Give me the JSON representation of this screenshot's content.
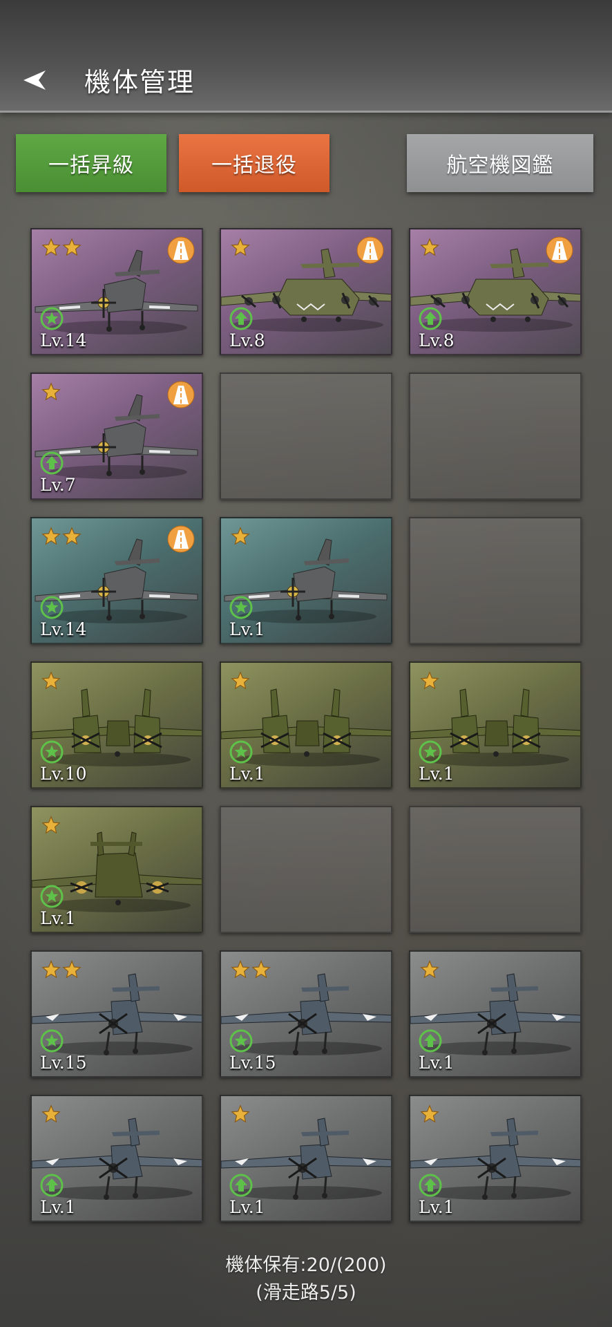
{
  "header": {
    "title": "機体管理"
  },
  "actions": {
    "bulk_upgrade": "一括昇級",
    "bulk_retire": "一括退役",
    "catalog": "航空機図鑑"
  },
  "colors": {
    "upgrade_button": "#4f9637",
    "retire_button": "#de6434",
    "catalog_button": "#999b9d",
    "star": "#e8b23a",
    "runway_badge": "#f0a040",
    "status_green": "#5ec24a"
  },
  "grid": {
    "columns": 3,
    "slots": [
      {
        "empty": false,
        "rarity": "purple",
        "stars": 2,
        "runway": true,
        "status": "star",
        "plane": "fighter",
        "level": "Lv.14"
      },
      {
        "empty": false,
        "rarity": "purple",
        "stars": 1,
        "runway": true,
        "status": "upgrade",
        "plane": "bomber4",
        "level": "Lv.8"
      },
      {
        "empty": false,
        "rarity": "purple",
        "stars": 1,
        "runway": true,
        "status": "upgrade",
        "plane": "bomber4",
        "level": "Lv.8"
      },
      {
        "empty": false,
        "rarity": "purple",
        "stars": 1,
        "runway": true,
        "status": "upgrade",
        "plane": "fighter",
        "level": "Lv.7"
      },
      {
        "empty": true
      },
      {
        "empty": true
      },
      {
        "empty": false,
        "rarity": "teal",
        "stars": 2,
        "runway": true,
        "status": "star",
        "plane": "fighter",
        "level": "Lv.14"
      },
      {
        "empty": false,
        "rarity": "teal",
        "stars": 1,
        "runway": false,
        "status": "star",
        "plane": "fighter",
        "level": "Lv.1"
      },
      {
        "empty": true
      },
      {
        "empty": false,
        "rarity": "olive",
        "stars": 1,
        "runway": false,
        "status": "star",
        "plane": "twin",
        "level": "Lv.10"
      },
      {
        "empty": false,
        "rarity": "olive",
        "stars": 1,
        "runway": false,
        "status": "star",
        "plane": "twin",
        "level": "Lv.1"
      },
      {
        "empty": false,
        "rarity": "olive",
        "stars": 1,
        "runway": false,
        "status": "star",
        "plane": "twin",
        "level": "Lv.1"
      },
      {
        "empty": false,
        "rarity": "olive",
        "stars": 1,
        "runway": false,
        "status": "star",
        "plane": "bomber2",
        "level": "Lv.1"
      },
      {
        "empty": true
      },
      {
        "empty": true
      },
      {
        "empty": false,
        "rarity": "gray",
        "stars": 2,
        "runway": false,
        "status": "star",
        "plane": "navy",
        "level": "Lv.15"
      },
      {
        "empty": false,
        "rarity": "gray",
        "stars": 2,
        "runway": false,
        "status": "star",
        "plane": "navy",
        "level": "Lv.15"
      },
      {
        "empty": false,
        "rarity": "gray",
        "stars": 1,
        "runway": false,
        "status": "upgrade",
        "plane": "navy",
        "level": "Lv.1"
      },
      {
        "empty": false,
        "rarity": "gray",
        "stars": 1,
        "runway": false,
        "status": "upgrade",
        "plane": "navy",
        "level": "Lv.1"
      },
      {
        "empty": false,
        "rarity": "gray",
        "stars": 1,
        "runway": false,
        "status": "upgrade",
        "plane": "navy",
        "level": "Lv.1"
      },
      {
        "empty": false,
        "rarity": "gray",
        "stars": 1,
        "runway": false,
        "status": "upgrade",
        "plane": "navy",
        "level": "Lv.1"
      }
    ]
  },
  "footer": {
    "owned": "機体保有:20/(200)",
    "runway": "(滑走路5/5)"
  }
}
